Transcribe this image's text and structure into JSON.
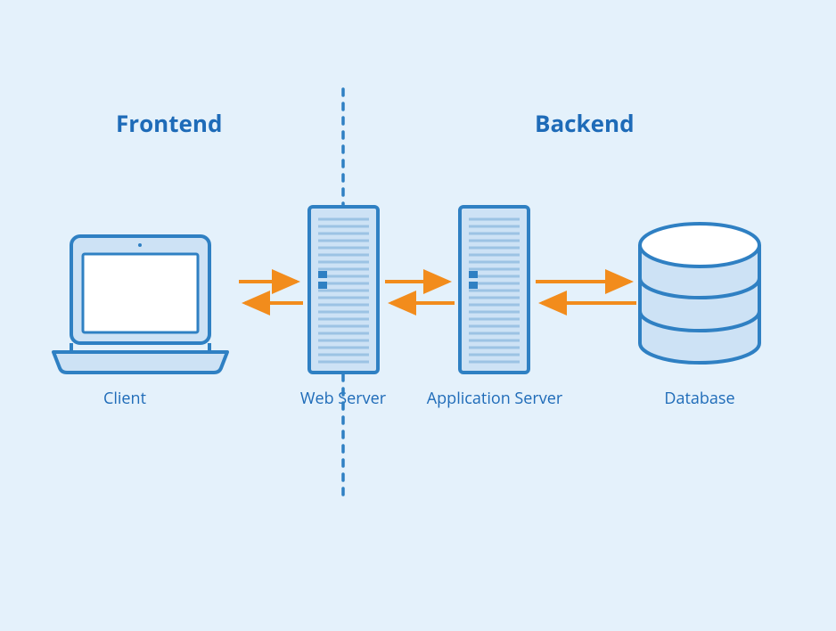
{
  "sections": {
    "frontend": "Frontend",
    "backend": "Backend"
  },
  "nodes": {
    "client": "Client",
    "web_server": "Web Server",
    "app_server": "Application Server",
    "database": "Database"
  },
  "colors": {
    "bg": "#e4f1fb",
    "stroke": "#2f80c3",
    "fill_light": "#cde2f5",
    "arrow": "#f28c1c",
    "text": "#1e6bb8"
  }
}
